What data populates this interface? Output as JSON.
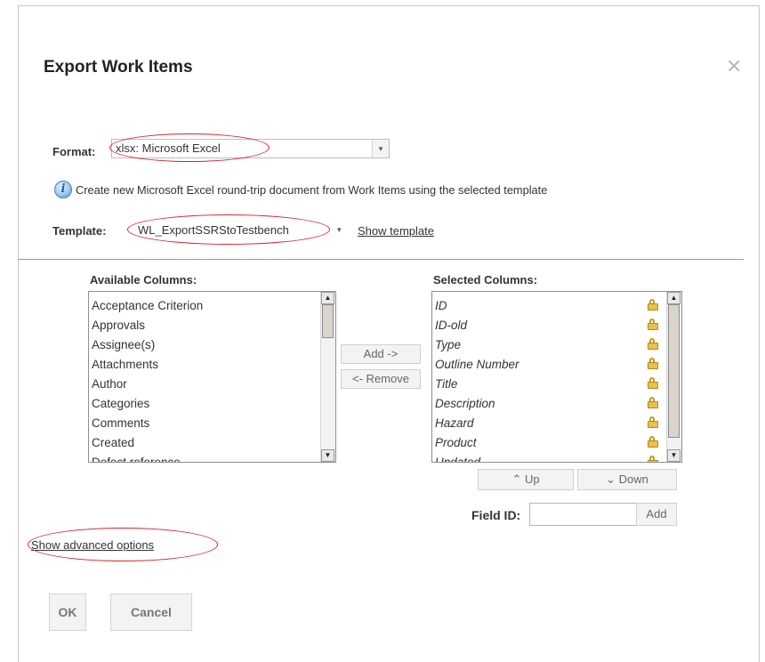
{
  "dialog": {
    "title": "Export Work Items",
    "close_icon": "✕"
  },
  "format": {
    "label": "Format:",
    "value": "xlsx: Microsoft Excel",
    "arrow": "▾"
  },
  "info": {
    "icon": "i",
    "text": "Create new Microsoft Excel round-trip document from Work Items using the selected template"
  },
  "template": {
    "label": "Template:",
    "value": "WL_ExportSSRStoTestbench",
    "arrow": "▾",
    "show_link": "Show template"
  },
  "available": {
    "header": "Available Columns:",
    "items": [
      "Acceptance Criterion",
      "Approvals",
      "Assignee(s)",
      "Attachments",
      "Author",
      "Categories",
      "Comments",
      "Created",
      "Defect reference"
    ]
  },
  "selected": {
    "header": "Selected Columns:",
    "items": [
      "ID",
      "ID-old",
      "Type",
      "Outline Number",
      "Title",
      "Description",
      "Hazard",
      "Product",
      "Updated"
    ]
  },
  "buttons": {
    "add": "Add ->",
    "remove": "<- Remove",
    "up": "⌃ Up",
    "down": "⌄ Down",
    "field_id_label": "Field ID:",
    "field_add": "Add",
    "ok": "OK",
    "cancel": "Cancel"
  },
  "advanced_link": "Show advanced options",
  "colors": {
    "annotation": "#d4232a",
    "lock": "#e8c14a"
  }
}
